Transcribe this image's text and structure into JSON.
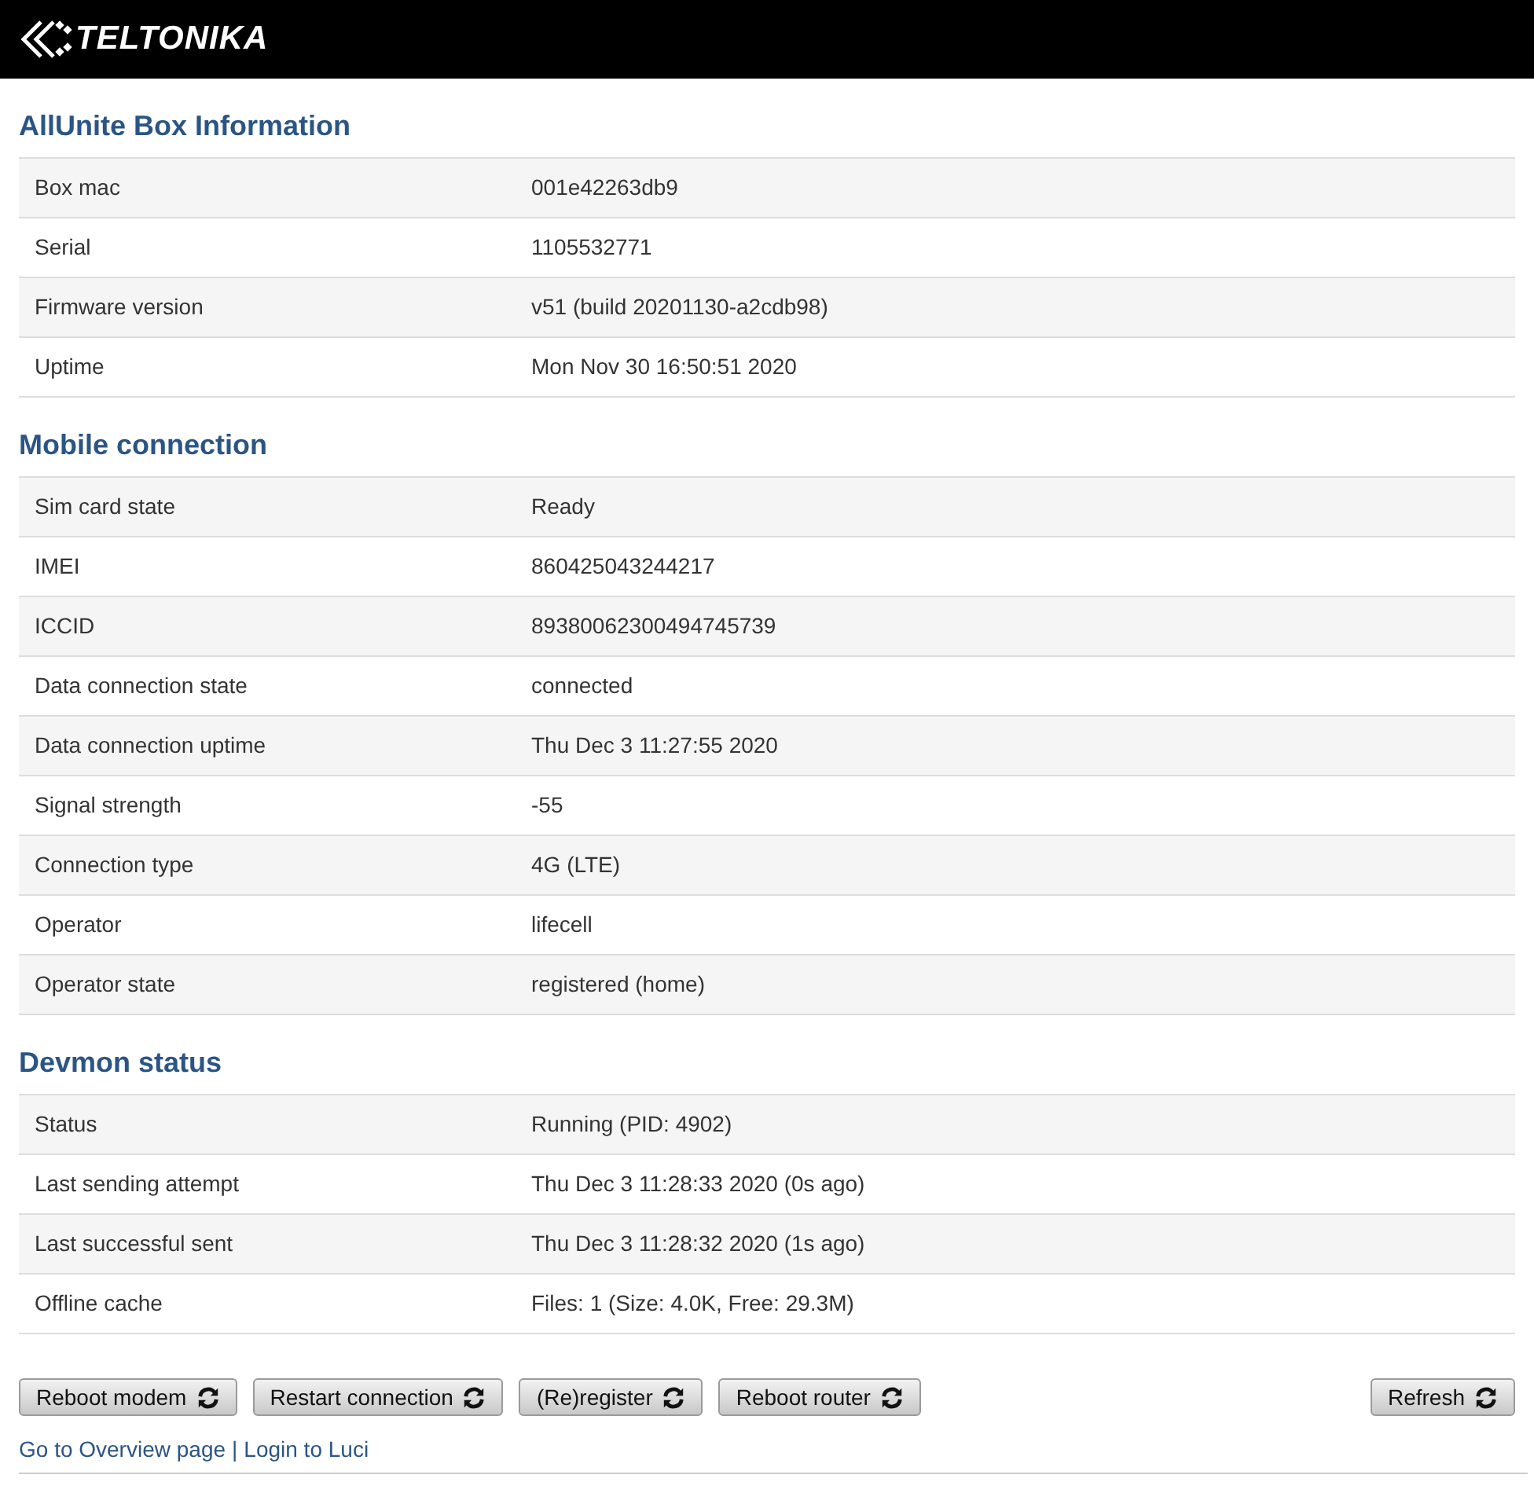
{
  "header": {
    "logo_text": "TELTONIKA"
  },
  "sections": [
    {
      "title": "AllUnite Box Information",
      "rows": [
        {
          "label": "Box mac",
          "value": "001e42263db9"
        },
        {
          "label": "Serial",
          "value": "1105532771"
        },
        {
          "label": "Firmware version",
          "value": "v51 (build 20201130-a2cdb98)"
        },
        {
          "label": "Uptime",
          "value": "Mon Nov 30 16:50:51 2020"
        }
      ]
    },
    {
      "title": "Mobile connection",
      "rows": [
        {
          "label": "Sim card state",
          "value": "Ready"
        },
        {
          "label": "IMEI",
          "value": "860425043244217"
        },
        {
          "label": "ICCID",
          "value": "89380062300494745739"
        },
        {
          "label": "Data connection state",
          "value": "connected"
        },
        {
          "label": "Data connection uptime",
          "value": "Thu Dec 3 11:27:55 2020"
        },
        {
          "label": "Signal strength",
          "value": "-55"
        },
        {
          "label": "Connection type",
          "value": "4G (LTE)"
        },
        {
          "label": "Operator",
          "value": "lifecell"
        },
        {
          "label": "Operator state",
          "value": "registered (home)"
        }
      ]
    },
    {
      "title": "Devmon status",
      "rows": [
        {
          "label": "Status",
          "value": "Running (PID: 4902)"
        },
        {
          "label": "Last sending attempt",
          "value": "Thu Dec 3 11:28:33 2020 (0s ago)"
        },
        {
          "label": "Last successful sent",
          "value": "Thu Dec 3 11:28:32 2020 (1s ago)"
        },
        {
          "label": "Offline cache",
          "value": "Files: 1 (Size: 4.0K, Free: 29.3M)"
        }
      ]
    }
  ],
  "actions": [
    "Reboot modem",
    "Restart connection",
    "(Re)register",
    "Reboot router"
  ],
  "refresh_button": "Refresh",
  "footer": {
    "links": [
      "Go to Overview page",
      "Login to Luci"
    ],
    "separator": "|"
  }
}
